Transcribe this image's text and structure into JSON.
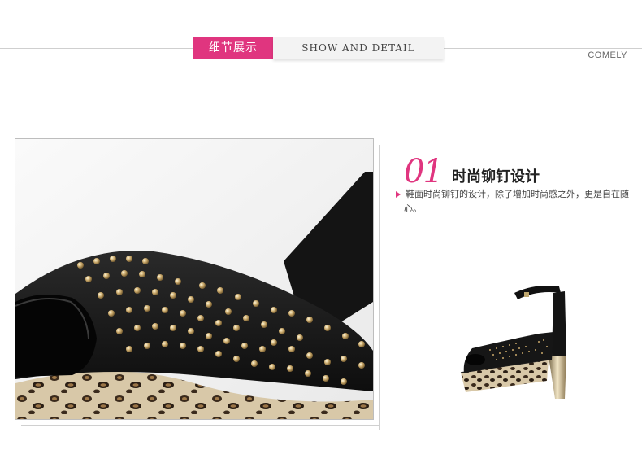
{
  "header": {
    "tag_cn": "细节展示",
    "tag_en": "SHOW AND DETAIL",
    "brand": "COMELY"
  },
  "detail": {
    "number": "01",
    "title": "时尚铆钉设计",
    "description": "鞋面时尚铆钉的设计，除了增加时尚感之外，更是自在随心。"
  },
  "colors": {
    "accent": "#e0357f"
  }
}
